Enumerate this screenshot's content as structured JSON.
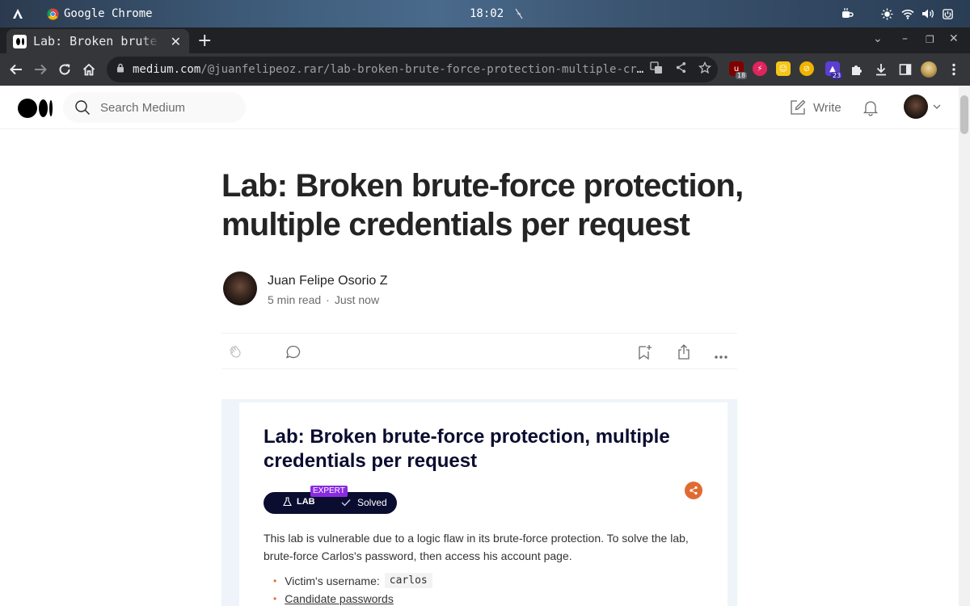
{
  "os_bar": {
    "app_name": "Google Chrome",
    "clock": "18:02"
  },
  "tabs": [
    {
      "title": "Lab: Broken brute-force protection, multiple credentials per request | by Juan Felipe Osorio Z",
      "active": true
    }
  ],
  "toolbar": {
    "url_host": "medium.com",
    "url_path": "/@juanfelipeoz.rar/lab-broken-brute-force-protection-multiple-credentials…",
    "extensions": [
      {
        "icon": "ublock-icon",
        "badge": "18",
        "color": "#800000"
      },
      {
        "icon": "lightning-icon",
        "badge": "",
        "color": "#e0245e"
      },
      {
        "icon": "face-icon",
        "badge": "",
        "color": "#f5c518"
      },
      {
        "icon": "block-icon",
        "badge": "",
        "color": "#f0b400"
      },
      {
        "icon": "hat-icon",
        "badge": "23",
        "color": "#5b3fd1"
      }
    ]
  },
  "medium_header": {
    "search_placeholder": "Search Medium",
    "write_label": "Write"
  },
  "article": {
    "title": "Lab: Broken brute-force protection, multiple credentials per request",
    "author": "Juan Felipe Osorio Z",
    "read_time": "5 min read",
    "separator": "·",
    "published": "Just now"
  },
  "embed": {
    "heading": "Lab: Broken brute-force protection, multiple credentials per request",
    "level_tag": "EXPERT",
    "pill_lab": "LAB",
    "pill_status": "Solved",
    "description": "This lab is vulnerable due to a logic flaw in its brute-force protection. To solve the lab, brute-force Carlos's password, then access his account page.",
    "victim_label": "Victim's username:",
    "victim_value": "carlos",
    "candidate_link": "Candidate passwords"
  },
  "colors": {
    "chrome_dark": "#202124",
    "chrome_toolbar": "#35363a",
    "medium_text": "#242424",
    "medium_muted": "#6b6b6b",
    "portswigger_navy": "#0a0c30",
    "portswigger_orange": "#e06b32",
    "expert_purple": "#8a2be2"
  }
}
